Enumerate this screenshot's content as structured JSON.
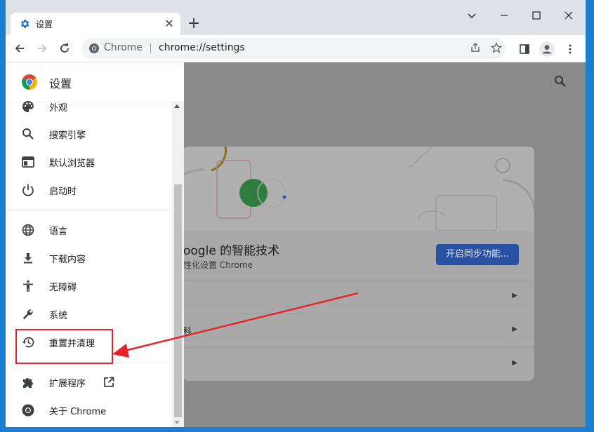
{
  "tab": {
    "icon": "gear-icon",
    "title": "设置",
    "close": "✕"
  },
  "newtab": "+",
  "window_controls": {
    "minimize": "chevron-down-icon",
    "restore": "square-icon",
    "close": "close-icon"
  },
  "omnibox": {
    "chip": "Chrome",
    "url": "chrome://settings"
  },
  "drawer": {
    "title": "设置",
    "items": [
      {
        "label": "外观",
        "icon": "palette-icon"
      },
      {
        "label": "搜索引擎",
        "icon": "search-icon"
      },
      {
        "label": "默认浏览器",
        "icon": "browser-icon"
      },
      {
        "label": "启动时",
        "icon": "power-icon"
      },
      {
        "label": "语言",
        "icon": "globe-icon"
      },
      {
        "label": "下载内容",
        "icon": "download-icon"
      },
      {
        "label": "无障碍",
        "icon": "accessibility-icon"
      },
      {
        "label": "系统",
        "icon": "wrench-icon"
      },
      {
        "label": "重置并清理",
        "icon": "history-icon"
      },
      {
        "label": "扩展程序",
        "icon": "puzzle-icon"
      },
      {
        "label": "关于 Chrome",
        "icon": "chrome-icon"
      }
    ]
  },
  "main": {
    "card_title": "oogle 的智能技术",
    "card_subtitle": "性化设置 Chrome",
    "sync_button": "开启同步功能...",
    "row2_text": "科"
  },
  "colors": {
    "accent": "#1a73e8",
    "highlight": "#e8212b",
    "desktop": "#1a7fd0"
  }
}
